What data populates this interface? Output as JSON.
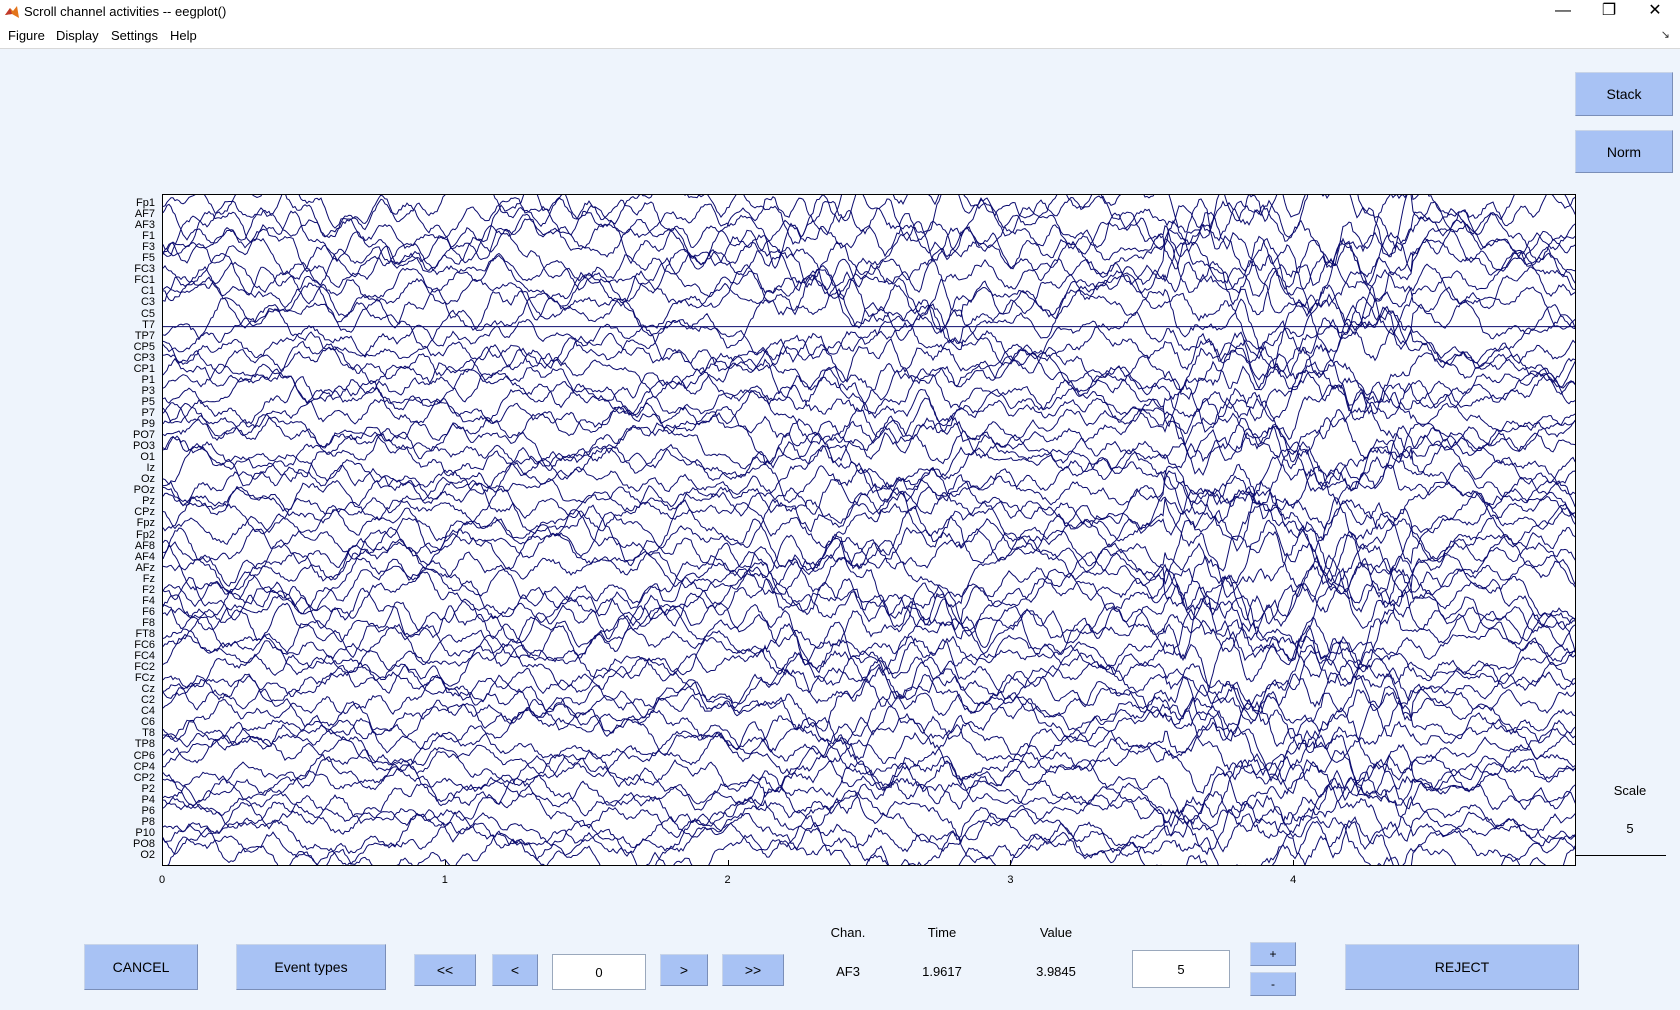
{
  "window": {
    "title": "Scroll channel activities -- eegplot()",
    "minimize": "—",
    "maximize": "❐",
    "close": "✕"
  },
  "menu": [
    "Figure",
    "Display",
    "Settings",
    "Help"
  ],
  "right_buttons": {
    "stack": "Stack",
    "norm": "Norm"
  },
  "channels": [
    "Fp1",
    "AF7",
    "AF3",
    "F1",
    "F3",
    "F5",
    "FC3",
    "FC1",
    "C1",
    "C3",
    "C5",
    "T7",
    "TP7",
    "CP5",
    "CP3",
    "CP1",
    "P1",
    "P3",
    "P5",
    "P7",
    "P9",
    "PO7",
    "PO3",
    "O1",
    "Iz",
    "Oz",
    "POz",
    "Pz",
    "CPz",
    "Fpz",
    "Fp2",
    "AF8",
    "AF4",
    "AFz",
    "Fz",
    "F2",
    "F4",
    "F6",
    "F8",
    "FT8",
    "FC6",
    "FC4",
    "FC2",
    "FCz",
    "Cz",
    "C2",
    "C4",
    "C6",
    "T8",
    "TP8",
    "CP6",
    "CP4",
    "CP2",
    "P2",
    "P4",
    "P6",
    "P8",
    "P10",
    "PO8",
    "O2"
  ],
  "x_ticks": [
    "0",
    "1",
    "2",
    "3",
    "4"
  ],
  "trace_color": "#0b0b6e",
  "scale": {
    "label": "Scale",
    "value": "5"
  },
  "bottom": {
    "cancel": "CANCEL",
    "event_types": "Event types",
    "first": "<<",
    "prev": "<",
    "position_value": "0",
    "next": ">",
    "last": ">>",
    "chan_label": "Chan.",
    "time_label": "Time",
    "value_label": "Value",
    "chan_value": "AF3",
    "time_value": "1.9617",
    "value_value": "3.9845",
    "scale_input": "5",
    "plus": "+",
    "minus": "-",
    "reject": "REJECT"
  }
}
